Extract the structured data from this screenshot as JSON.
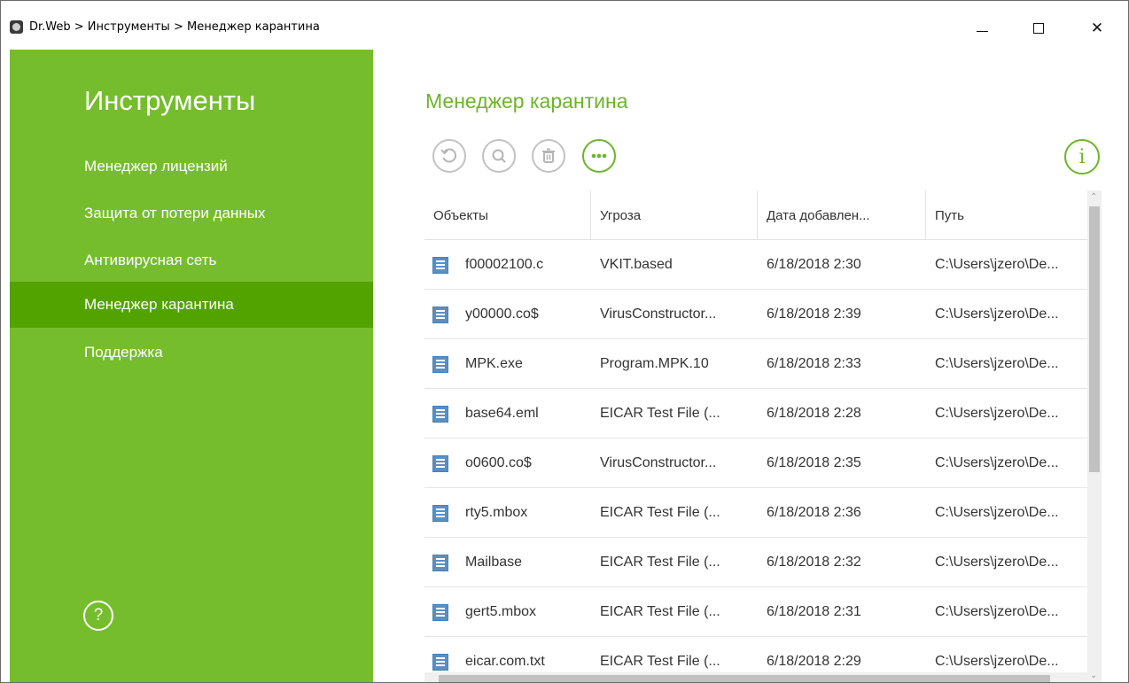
{
  "window": {
    "title": "Dr.Web > Инструменты > Менеджер карантина",
    "minimize_glyph": "—",
    "maximize_glyph": "☐",
    "close_glyph": "✕"
  },
  "sidebar": {
    "title": "Инструменты",
    "items": [
      {
        "label": "Менеджер лицензий",
        "active": false
      },
      {
        "label": "Защита от потери данных",
        "active": false
      },
      {
        "label": "Антивирусная сеть",
        "active": false
      },
      {
        "label": "Менеджер карантина",
        "active": true
      },
      {
        "label": "Поддержка",
        "active": false
      }
    ],
    "help_glyph": "?"
  },
  "main": {
    "title": "Менеджер карантина",
    "toolbar": {
      "icons": [
        "restore-icon",
        "search-icon",
        "delete-icon",
        "more-icon"
      ],
      "info_glyph": "i"
    },
    "table": {
      "columns": [
        "Объекты",
        "Угроза",
        "Дата добавлен...",
        "Путь"
      ],
      "rows": [
        [
          "f00002100.c",
          "VKIT.based",
          "6/18/2018 2:30",
          "C:\\Users\\jzero\\De..."
        ],
        [
          "y00000.co$",
          "VirusConstructor...",
          "6/18/2018 2:39",
          "C:\\Users\\jzero\\De..."
        ],
        [
          "MPK.exe",
          "Program.MPK.10",
          "6/18/2018 2:33",
          "C:\\Users\\jzero\\De..."
        ],
        [
          "base64.eml",
          "EICAR Test File (...",
          "6/18/2018 2:28",
          "C:\\Users\\jzero\\De..."
        ],
        [
          "o0600.co$",
          "VirusConstructor...",
          "6/18/2018 2:35",
          "C:\\Users\\jzero\\De..."
        ],
        [
          "rty5.mbox",
          "EICAR Test File (...",
          "6/18/2018 2:36",
          "C:\\Users\\jzero\\De..."
        ],
        [
          "Mailbase",
          "EICAR Test File (...",
          "6/18/2018 2:32",
          "C:\\Users\\jzero\\De..."
        ],
        [
          "gert5.mbox",
          "EICAR Test File (...",
          "6/18/2018 2:31",
          "C:\\Users\\jzero\\De..."
        ],
        [
          "eicar.com.txt",
          "EICAR Test File (...",
          "6/18/2018 2:29",
          "C:\\Users\\jzero\\De..."
        ]
      ]
    }
  },
  "colors": {
    "accent": "#76bd2e",
    "active_nav": "#52a300",
    "title_green": "#6cb52a",
    "file_icon": "#5a8fc4"
  }
}
